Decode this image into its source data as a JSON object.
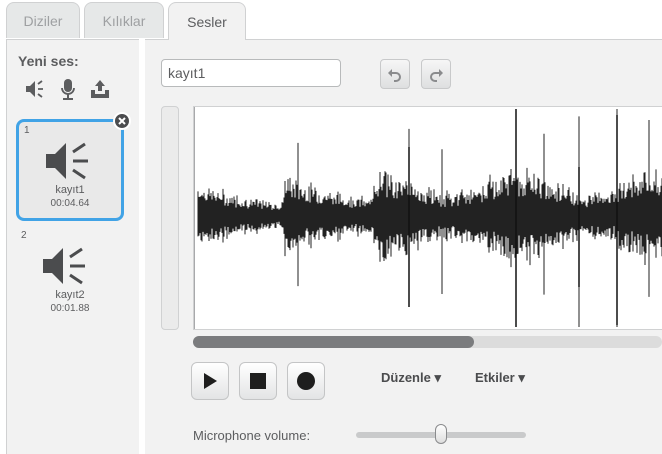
{
  "tabs": [
    {
      "label": "Diziler",
      "active": false
    },
    {
      "label": "Kılıklar",
      "active": false
    },
    {
      "label": "Sesler",
      "active": true
    }
  ],
  "sidebar": {
    "new_sound_label": "Yeni ses:",
    "new_sound_icons": [
      "speaker-library-icon",
      "microphone-icon",
      "upload-icon"
    ],
    "sounds": [
      {
        "index": "1",
        "name": "kayıt1",
        "duration": "00:04.64",
        "selected": true
      },
      {
        "index": "2",
        "name": "kayıt2",
        "duration": "00:01.88",
        "selected": false
      }
    ]
  },
  "editor": {
    "sound_name_value": "kayıt1",
    "undo_icon": "undo-icon",
    "redo_icon": "redo-icon",
    "scroll_position": 0.6,
    "controls": [
      "play-icon",
      "stop-icon",
      "record-icon"
    ],
    "edit_menu_label": "Düzenle ▾",
    "effects_menu_label": "Etkiler ▾",
    "mic_volume_label": "Microphone volume:",
    "mic_volume_level": 0.5
  },
  "colors": {
    "accent": "#41a3e6",
    "waveform": "#222222",
    "panel_bg": "#f2f2f2"
  }
}
